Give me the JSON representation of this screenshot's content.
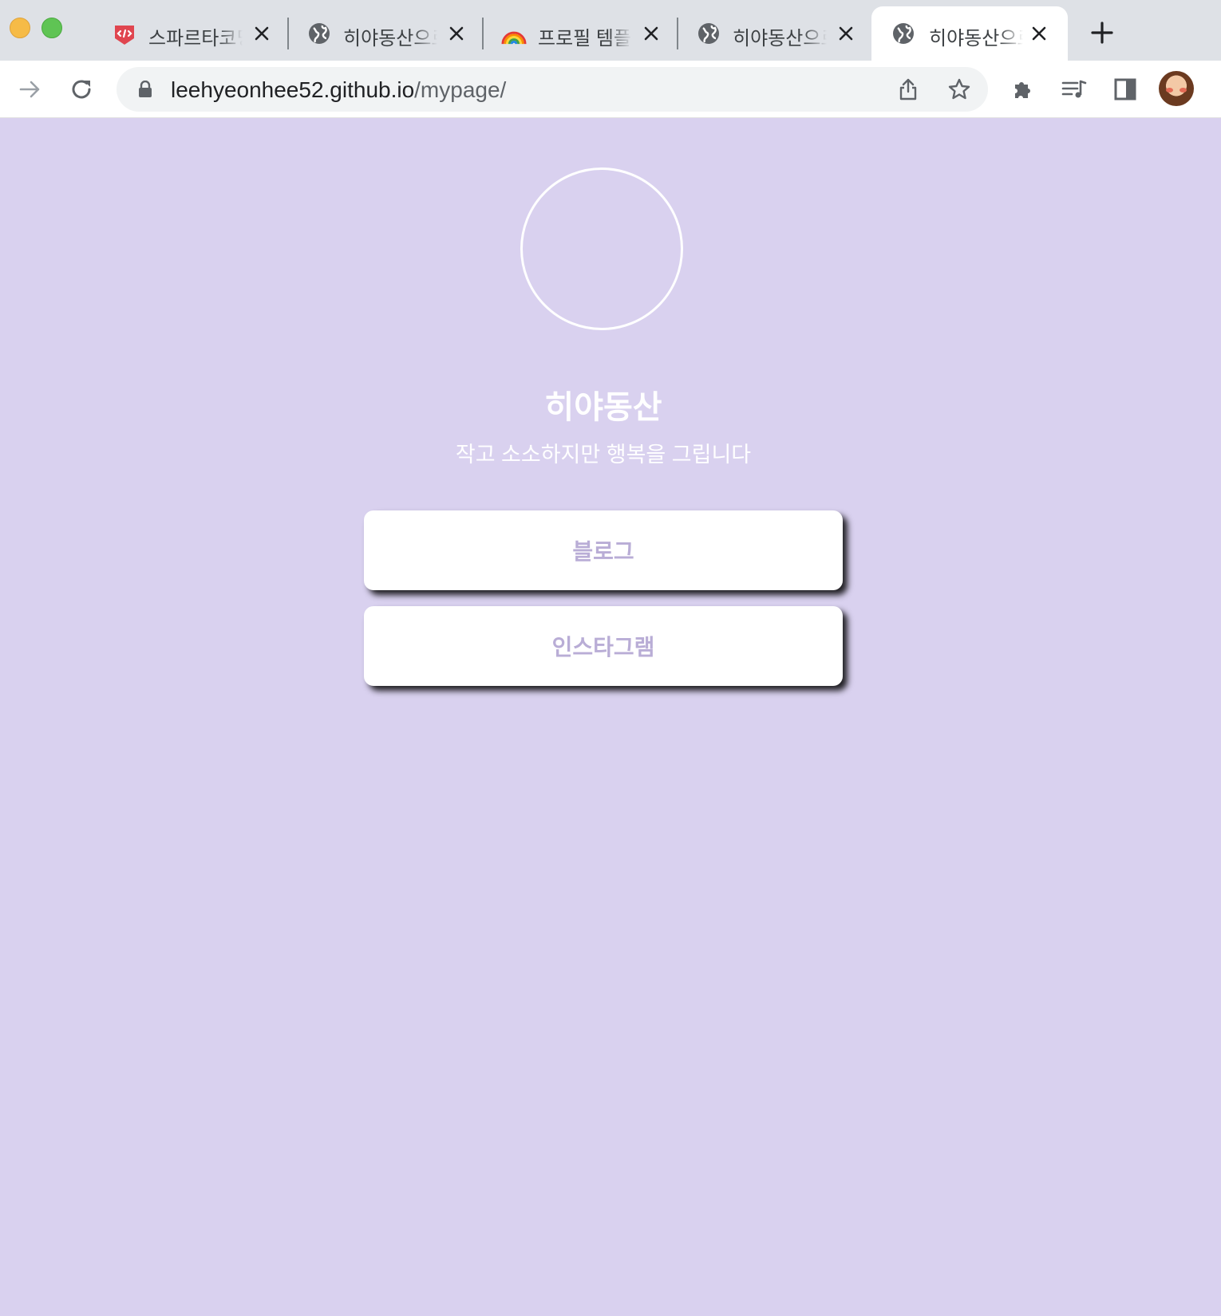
{
  "browser": {
    "tabs": [
      {
        "title": "스파르타코딩",
        "icon": "sparta-logo-icon",
        "active": false
      },
      {
        "title": "히야동산으로",
        "icon": "globe-icon",
        "active": false
      },
      {
        "title": "프로필 템플릿",
        "icon": "rainbow-icon",
        "active": false
      },
      {
        "title": "히야동산으로",
        "icon": "globe-icon",
        "active": false
      },
      {
        "title": "히야동산으로",
        "icon": "globe-icon",
        "active": true
      }
    ],
    "address": {
      "host": "leehyeonhee52.github.io",
      "path": "/mypage/"
    }
  },
  "profile": {
    "name": "히야동산",
    "description": "작고 소소하지만 행복을 그립니다"
  },
  "links": [
    {
      "label": "블로그"
    },
    {
      "label": "인스타그램"
    }
  ],
  "colors": {
    "page_background": "#d9d1ef",
    "button_text": "#b9add6",
    "tabstrip": "#dee1e6"
  }
}
